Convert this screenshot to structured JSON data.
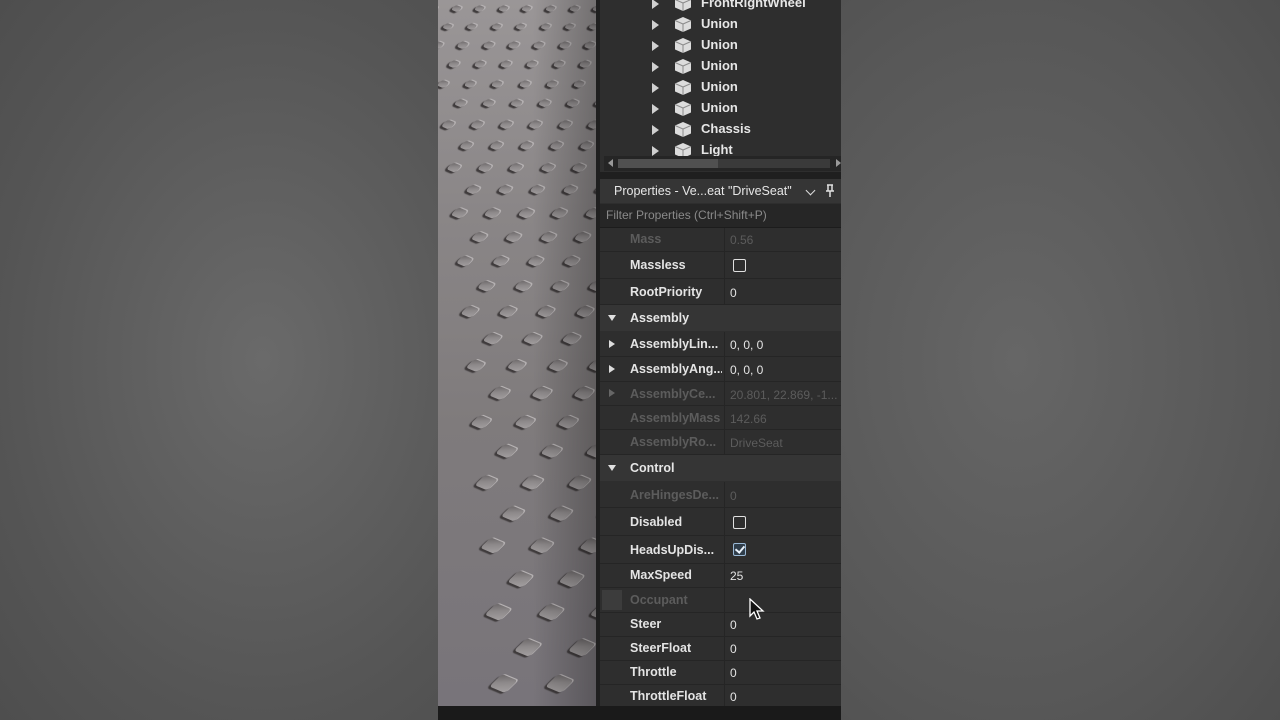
{
  "explorer": {
    "items": [
      {
        "label": "FrontRightWheel"
      },
      {
        "label": "Union"
      },
      {
        "label": "Union"
      },
      {
        "label": "Union"
      },
      {
        "label": "Union"
      },
      {
        "label": "Union"
      },
      {
        "label": "Chassis"
      },
      {
        "label": "Light"
      }
    ]
  },
  "properties": {
    "title": "Properties - Ve...eat \"DriveSeat\"",
    "filter_placeholder": "Filter Properties (Ctrl+Shift+P)",
    "rows": {
      "mass": {
        "name": "Mass",
        "value": "0.56"
      },
      "massless": {
        "name": "Massless",
        "checked": false
      },
      "root_priority": {
        "name": "RootPriority",
        "value": "0"
      },
      "assembly_section": "Assembly",
      "assembly_lin": {
        "name": "AssemblyLin...",
        "value": "0, 0, 0"
      },
      "assembly_ang": {
        "name": "AssemblyAng...",
        "value": "0, 0, 0"
      },
      "assembly_ce": {
        "name": "AssemblyCe...",
        "value": "20.801, 22.869, -1..."
      },
      "assembly_mass": {
        "name": "AssemblyMass",
        "value": "142.66"
      },
      "assembly_ro": {
        "name": "AssemblyRo...",
        "value": "DriveSeat"
      },
      "control_section": "Control",
      "are_hinges": {
        "name": "AreHingesDe...",
        "value": "0"
      },
      "disabled": {
        "name": "Disabled",
        "checked": false
      },
      "heads_up": {
        "name": "HeadsUpDis...",
        "checked": true
      },
      "max_speed": {
        "name": "MaxSpeed",
        "value": "25"
      },
      "occupant": {
        "name": "Occupant",
        "value": ""
      },
      "steer": {
        "name": "Steer",
        "value": "0"
      },
      "steer_float": {
        "name": "SteerFloat",
        "value": "0"
      },
      "throttle": {
        "name": "Throttle",
        "value": "0"
      },
      "throttle_float": {
        "name": "ThrottleFloat",
        "value": "0"
      }
    }
  },
  "colors": {
    "panel_bg": "#2e2e2e",
    "section_bg": "#353535",
    "text": "#e4e4e4",
    "dim_text": "#5c5c5c",
    "checkbox_checked": "#9ab9d6"
  }
}
